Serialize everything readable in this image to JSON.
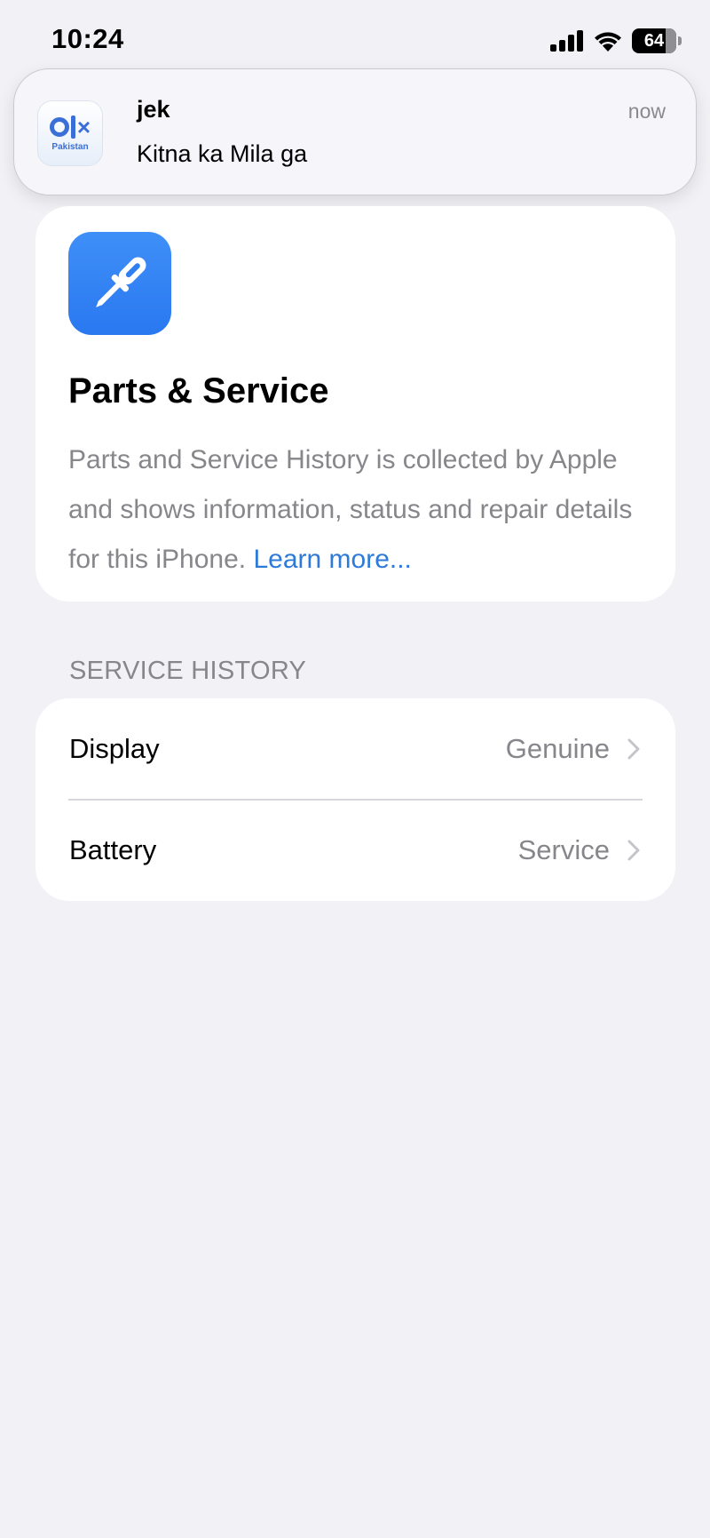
{
  "status_bar": {
    "time": "10:24",
    "battery_level": "64",
    "icons": [
      "signal-icon",
      "wifi-icon",
      "battery-icon"
    ]
  },
  "notification": {
    "app_icon": "olx-app-icon",
    "app_icon_sub": "Pakistan",
    "title": "jek",
    "time": "now",
    "body": "Kitna ka Mila ga"
  },
  "info_card": {
    "icon": "screwdriver-icon",
    "title": "Parts & Service",
    "description": "Parts and Service History is collected by Apple and shows information, status and repair details for this iPhone.",
    "learn_more": "Learn more..."
  },
  "service_history": {
    "header": "SERVICE HISTORY",
    "items": [
      {
        "label": "Display",
        "value": "Genuine"
      },
      {
        "label": "Battery",
        "value": "Service"
      }
    ]
  },
  "colors": {
    "background": "#f1f1f6",
    "accent_blue": "#2d7ad8",
    "icon_blue": "#3486f6",
    "secondary_text": "#86868b"
  }
}
